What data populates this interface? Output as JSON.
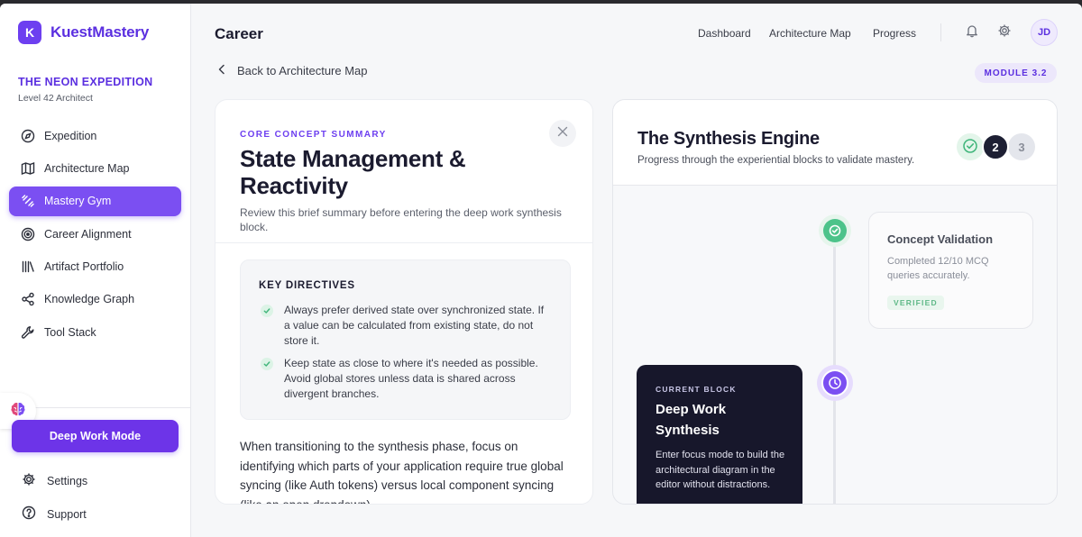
{
  "brand": {
    "logo_letter": "K",
    "name": "KuestMastery"
  },
  "expedition": {
    "title": "THE NEON EXPEDITION",
    "subtitle": "Level 42 Architect"
  },
  "sidebar": {
    "items": [
      {
        "label": "Expedition",
        "icon": "compass-icon"
      },
      {
        "label": "Architecture Map",
        "icon": "map-icon"
      },
      {
        "label": "Mastery Gym",
        "icon": "dumbbell-icon",
        "active": true
      },
      {
        "label": "Career Alignment",
        "icon": "target-icon"
      },
      {
        "label": "Artifact Portfolio",
        "icon": "library-icon"
      },
      {
        "label": "Knowledge Graph",
        "icon": "share-nodes-icon"
      },
      {
        "label": "Tool Stack",
        "icon": "wrench-icon"
      }
    ],
    "deep_work_label": "Deep Work Mode",
    "settings_label": "Settings",
    "support_label": "Support"
  },
  "header": {
    "title": "Career",
    "nav": [
      "Dashboard",
      "Architecture Map",
      "Progress"
    ],
    "avatar_initials": "JD"
  },
  "back_link": "Back to Architecture Map",
  "module_badge": "MODULE 3.2",
  "concept": {
    "eyebrow": "CORE CONCEPT SUMMARY",
    "title": "State Management & Reactivity",
    "description": "Review this brief summary before entering the deep work synthesis block.",
    "directives_title": "KEY DIRECTIVES",
    "directives": [
      "Always prefer derived state over synchronized state. If a value can be calculated from existing state, do not store it.",
      "Keep state as close to where it's needed as possible. Avoid global stores unless data is shared across divergent branches."
    ],
    "body": "When transitioning to the synthesis phase, focus on identifying which parts of your application require true global syncing (like Auth tokens) versus local component syncing (like an open dropdown)."
  },
  "engine": {
    "title": "The Synthesis Engine",
    "subtitle": "Progress through the experiential blocks to validate mastery.",
    "steps": [
      "2",
      "3"
    ],
    "validation": {
      "title": "Concept Validation",
      "description": "Completed 12/10 MCQ queries accurately.",
      "badge": "VERIFIED"
    },
    "current_block": {
      "eyebrow": "CURRENT BLOCK",
      "title": "Deep Work Synthesis",
      "description": "Enter focus mode to build the architectural diagram in the editor without distractions."
    }
  },
  "colors": {
    "accent": "#6d3ff0",
    "success": "#4cc38a",
    "dark": "#17172b"
  }
}
